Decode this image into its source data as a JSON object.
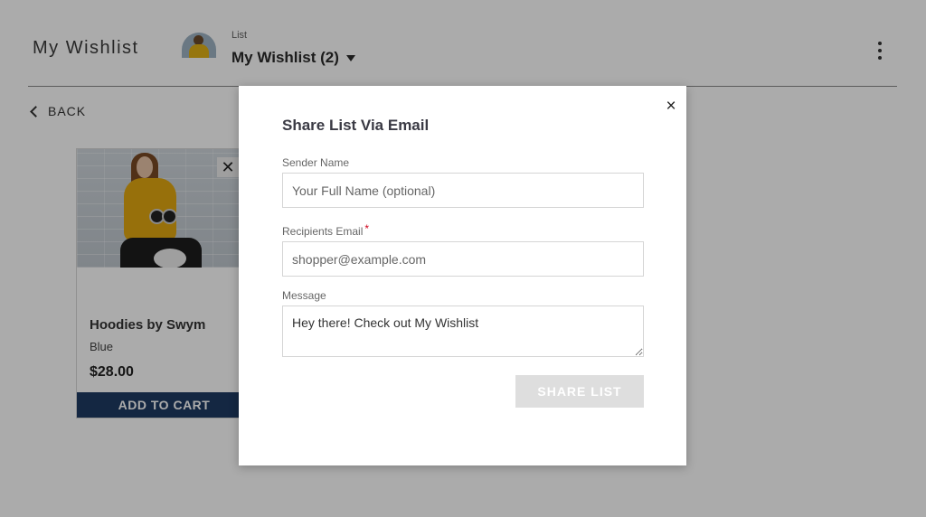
{
  "header": {
    "title": "My Wishlist",
    "list_caption": "List",
    "list_name": "My Wishlist (2)",
    "menu_icon": "more-vertical-icon"
  },
  "nav": {
    "back_label": "BACK",
    "back_icon": "chevron-left-icon"
  },
  "product_card": {
    "name": "Hoodies by Swym",
    "variant": "Blue",
    "price": "$28.00",
    "add_to_cart_label": "ADD TO CART",
    "remove_glyph": "✕"
  },
  "modal": {
    "title": "Share List Via Email",
    "close_glyph": "×",
    "sender": {
      "label": "Sender Name",
      "placeholder": "Your Full Name (optional)",
      "value": ""
    },
    "recipient": {
      "label": "Recipients Email",
      "required_mark": "*",
      "placeholder": "shopper@example.com",
      "value": ""
    },
    "message": {
      "label": "Message",
      "value": "Hey there! Check out My Wishlist"
    },
    "share_button_label": "SHARE LIST"
  },
  "colors": {
    "overlay": "rgba(0,0,0,0.33)",
    "add_to_cart_bg": "#1f3b63",
    "share_button_disabled_bg": "#dedede",
    "required_star": "#d0021b"
  }
}
